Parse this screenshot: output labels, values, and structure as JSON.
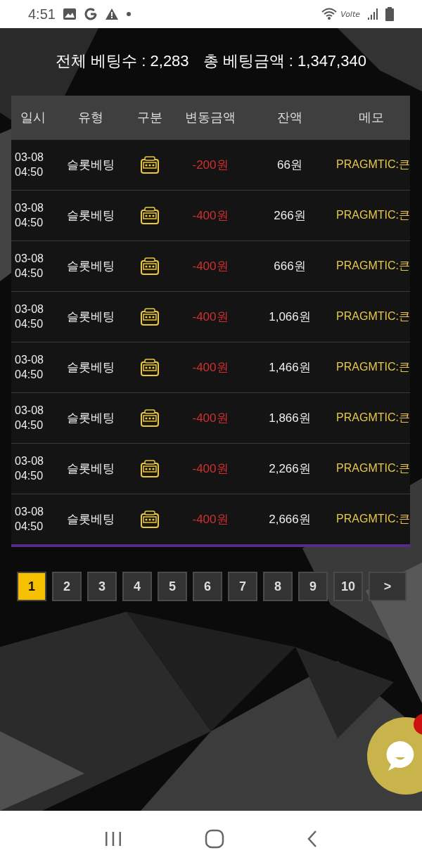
{
  "status_bar": {
    "time": "4:51",
    "network_label": "Volte"
  },
  "summary": {
    "total_bets": "전체 베팅수 : 2,283",
    "total_amount": "총 베팅금액 : 1,347,340"
  },
  "table": {
    "columns": [
      "일시",
      "유형",
      "구분",
      "변동금액",
      "잔액",
      "메모"
    ],
    "rows": [
      {
        "date": "03-08",
        "time": "04:50",
        "type": "슬롯베팅",
        "kind": "slot",
        "change": "-200원",
        "balance": "66원",
        "memo": "PRAGMTIC:큰"
      },
      {
        "date": "03-08",
        "time": "04:50",
        "type": "슬롯베팅",
        "kind": "slot",
        "change": "-400원",
        "balance": "266원",
        "memo": "PRAGMTIC:큰"
      },
      {
        "date": "03-08",
        "time": "04:50",
        "type": "슬롯베팅",
        "kind": "slot",
        "change": "-400원",
        "balance": "666원",
        "memo": "PRAGMTIC:큰"
      },
      {
        "date": "03-08",
        "time": "04:50",
        "type": "슬롯베팅",
        "kind": "slot",
        "change": "-400원",
        "balance": "1,066원",
        "memo": "PRAGMTIC:큰"
      },
      {
        "date": "03-08",
        "time": "04:50",
        "type": "슬롯베팅",
        "kind": "slot",
        "change": "-400원",
        "balance": "1,466원",
        "memo": "PRAGMTIC:큰"
      },
      {
        "date": "03-08",
        "time": "04:50",
        "type": "슬롯베팅",
        "kind": "slot",
        "change": "-400원",
        "balance": "1,866원",
        "memo": "PRAGMTIC:큰"
      },
      {
        "date": "03-08",
        "time": "04:50",
        "type": "슬롯베팅",
        "kind": "slot",
        "change": "-400원",
        "balance": "2,266원",
        "memo": "PRAGMTIC:큰"
      },
      {
        "date": "03-08",
        "time": "04:50",
        "type": "슬롯베팅",
        "kind": "slot",
        "change": "-400원",
        "balance": "2,666원",
        "memo": "PRAGMTIC:큰"
      }
    ]
  },
  "pagination": {
    "pages": [
      {
        "label": "1",
        "selected": true
      },
      {
        "label": "2",
        "selected": false
      },
      {
        "label": "3",
        "selected": false
      },
      {
        "label": "4",
        "selected": false
      },
      {
        "label": "5",
        "selected": false
      },
      {
        "label": "6",
        "selected": false
      },
      {
        "label": "7",
        "selected": false
      },
      {
        "label": "8",
        "selected": false
      },
      {
        "label": "9",
        "selected": false
      },
      {
        "label": "10",
        "selected": false
      }
    ],
    "next": ">"
  },
  "chat_button": {
    "badge": true
  }
}
